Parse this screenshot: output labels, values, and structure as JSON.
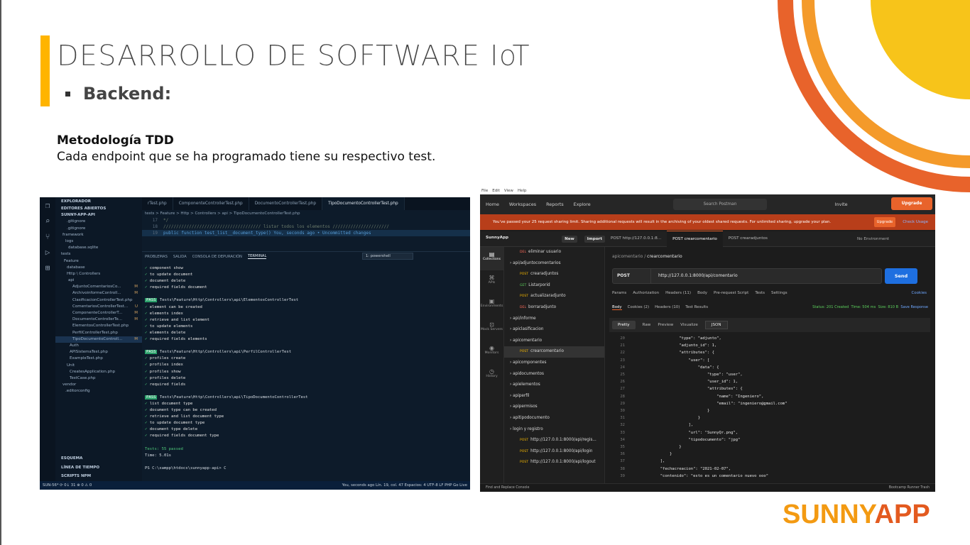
{
  "slide": {
    "title": "DESARROLLO DE SOFTWARE IoT",
    "bullet": "Backend:",
    "section_title": "Metodología TDD",
    "section_desc": "Cada endpoint que se ha programado tiene su respectivo test.",
    "logo_part1": "SUNNY",
    "logo_part2": "APP"
  },
  "colors": {
    "accent_yellow": "#ffb400",
    "arc_orange": "#e8632b",
    "arc_yellow": "#f7c41a"
  },
  "vscode": {
    "sidebar_title": "EXPLORADOR",
    "open_editors": "EDITORES ABIERTOS",
    "project": "SUNNY-APP-API",
    "tree": [
      {
        "label": ".gitignore",
        "badge": ""
      },
      {
        "label": ".gitignore",
        "badge": ""
      },
      {
        "label": "framework",
        "badge": ""
      },
      {
        "label": "logs",
        "badge": ""
      },
      {
        "label": "database.sqlite",
        "badge": ""
      },
      {
        "label": "tests",
        "badge": ""
      },
      {
        "label": "Feature",
        "badge": ""
      },
      {
        "label": "database",
        "badge": ""
      },
      {
        "label": "Http \\ Controllers",
        "badge": ""
      },
      {
        "label": "api",
        "badge": ""
      },
      {
        "label": "AdjuntoComentariosCo...",
        "badge": "M"
      },
      {
        "label": "ArchivoinformeControll...",
        "badge": "M"
      },
      {
        "label": "ClasificacionControllerTest.php",
        "badge": ""
      },
      {
        "label": "ComentariosControllerTest...",
        "badge": "U"
      },
      {
        "label": "ComponenteControllerT...",
        "badge": "M"
      },
      {
        "label": "DocumentoControllerTe...",
        "badge": "M"
      },
      {
        "label": "ElementosControllerTest.php",
        "badge": ""
      },
      {
        "label": "PerfilControllerTest.php",
        "badge": ""
      },
      {
        "label": "TipoDocumentoControll...",
        "badge": "M"
      },
      {
        "label": "Auth",
        "badge": ""
      },
      {
        "label": "APISistemaTest.php",
        "badge": ""
      },
      {
        "label": "ExampleTest.php",
        "badge": ""
      },
      {
        "label": "Unit",
        "badge": ""
      },
      {
        "label": "CreatesApplication.php",
        "badge": ""
      },
      {
        "label": "TestCase.php",
        "badge": ""
      },
      {
        "label": "vendor",
        "badge": ""
      },
      {
        "label": ".editorconfig",
        "badge": ""
      }
    ],
    "outline": "ESQUEMA",
    "timeline": "LÍNEA DE TIEMPO",
    "npm": "SCRIPTS NPM",
    "tabs": [
      "rTest.php",
      "ComponenteControllerTest.php",
      "DocumentoControllerTest.php",
      "TipoDocumentoControllerTest.php"
    ],
    "breadcrumb": "tests > Feature > Http > Controllers > api > TipoDocumentoControllerTest.php",
    "code_lines": [
      {
        "n": "17",
        "text": "*/"
      },
      {
        "n": "18",
        "text": "////////////////////////////////////// listar todos los elementos //////////////////////"
      },
      {
        "n": "19",
        "text": "public function test_list__document_type()       You, seconds ago • Uncommitted changes"
      }
    ],
    "panel_tabs": [
      "PROBLEMAS",
      "SALIDA",
      "CONSOLA DE DEPURACIÓN",
      "TERMINAL"
    ],
    "shell": "1: powershell",
    "terminal": [
      "✓ component show",
      "✓ to update document",
      "✓ document delete",
      "✓ required fields document",
      "",
      "PASS  Tests\\Feature\\Http\\Controllers\\api\\ElementosControllerTest",
      "✓ element can be created",
      "✓ elements index",
      "✓ retrieve and list element",
      "✓ to update elements",
      "✓ elements delete",
      "✓ required fields elements",
      "",
      "PASS  Tests\\Feature\\Http\\Controllers\\api\\PerfilControllerTest",
      "✓ profiles create",
      "✓ profiles index",
      "✓ profiles show",
      "✓ profiles delete",
      "✓ required fields",
      "",
      "PASS  Tests\\Feature\\Http\\Controllers\\api\\TipoDocumentoControllerTest",
      "✓ list  document type",
      "✓ document type can be created",
      "✓ retrieve and list  document type",
      "✓ to update document type",
      "✓ document type delete",
      "✓ required fields document type",
      "",
      "Tests:  55 passed",
      "Time:   5.01s",
      "",
      "PS C:\\xampp\\htdocs\\sunnyapp-api> C"
    ],
    "status_left": "SUN-56*  ⟳ 0↓ 31  ⊗ 0 ⚠ 0",
    "status_right": "You, seconds ago   Lín. 19, col. 47   Espacios: 4   UTF-8   LF   PHP   Go Live"
  },
  "postman": {
    "menubar": [
      "File",
      "Edit",
      "View",
      "Help"
    ],
    "nav": [
      "Home",
      "Workspaces",
      "Reports",
      "Explore"
    ],
    "search": "Search Postman",
    "invite": "Invite",
    "upgrade": "Upgrade",
    "warning": "You've passed your 25 request sharing limit. Sharing additional requests will result in the archiving of your oldest shared requests. For unlimited sharing, upgrade your plan.",
    "warning_btn": "Upgrade",
    "warning_link": "Check Usage",
    "workspace": "SunnyApp",
    "new_btn": "New",
    "import_btn": "Import",
    "req_tabs": [
      "POST  http://127.0.0.1:8...",
      "POST  crearcomentario",
      "POST  crearadjuntos"
    ],
    "env": "No Environment",
    "rail": [
      "Collections",
      "APIs",
      "Environments",
      "Mock Servers",
      "Monitors",
      "History"
    ],
    "tree": [
      {
        "m": "DEL",
        "label": "eliminar usuario",
        "indent": 2
      },
      {
        "m": "",
        "label": "api/adjuntocomentarios",
        "indent": 1
      },
      {
        "m": "POST",
        "label": "crearadjuntos",
        "indent": 2
      },
      {
        "m": "GET",
        "label": "Listarporid",
        "indent": 2
      },
      {
        "m": "POST",
        "label": "actualizaradjunto",
        "indent": 2
      },
      {
        "m": "DEL",
        "label": "borraradjunto",
        "indent": 2
      },
      {
        "m": "",
        "label": "api/informe",
        "indent": 1
      },
      {
        "m": "",
        "label": "apiclasificacion",
        "indent": 1
      },
      {
        "m": "",
        "label": "apicomentario",
        "indent": 1
      },
      {
        "m": "POST",
        "label": "crearcomentario",
        "indent": 2
      },
      {
        "m": "",
        "label": "apicomponentes",
        "indent": 1
      },
      {
        "m": "",
        "label": "apidocumentos",
        "indent": 1
      },
      {
        "m": "",
        "label": "apielementos",
        "indent": 1
      },
      {
        "m": "",
        "label": "apiperfil",
        "indent": 1
      },
      {
        "m": "",
        "label": "apipermisos",
        "indent": 1
      },
      {
        "m": "",
        "label": "apitipodocumento",
        "indent": 1
      },
      {
        "m": "",
        "label": "login y registro",
        "indent": 1
      },
      {
        "m": "POST",
        "label": "http://127.0.0.1:8000/api/regis...",
        "indent": 2
      },
      {
        "m": "POST",
        "label": "http://127.0.0.1:8000/api/login",
        "indent": 2
      },
      {
        "m": "POST",
        "label": "http://127.0.0.1:8000/api/logout",
        "indent": 2
      }
    ],
    "crumb_parent": "apicomentario",
    "crumb_current": "crearcomentario",
    "method": "POST",
    "url": "http://127.0.0.1:8000/api/comentario",
    "send": "Send",
    "req_subtabs": [
      "Params",
      "Authorization",
      "Headers (11)",
      "Body",
      "Pre-request Script",
      "Tests",
      "Settings"
    ],
    "cookies": "Cookies",
    "res_tabs": [
      "Body",
      "Cookies (2)",
      "Headers (10)",
      "Test Results"
    ],
    "status": "Status: 201 Created",
    "time": "Time: 504 ms",
    "size": "Size: 810 B",
    "save_response": "Save Response",
    "fmt": [
      "Pretty",
      "Raw",
      "Preview",
      "Visualize"
    ],
    "fmt_type": "JSON",
    "body_lines": [
      {
        "n": "20",
        "t": "                    \"type\": \"adjunto\","
      },
      {
        "n": "21",
        "t": "                    \"adjunto_id\": 1,"
      },
      {
        "n": "22",
        "t": "                    \"attributes\": {"
      },
      {
        "n": "23",
        "t": "                        \"user\": ["
      },
      {
        "n": "24",
        "t": "                            \"data\": {"
      },
      {
        "n": "25",
        "t": "                                \"type\": \"user\","
      },
      {
        "n": "26",
        "t": "                                \"user_id\": 1,"
      },
      {
        "n": "27",
        "t": "                                \"attributes\": {"
      },
      {
        "n": "28",
        "t": "                                    \"name\": \"Ingeniero\","
      },
      {
        "n": "29",
        "t": "                                    \"email\": \"ingeniero@gmail.com\""
      },
      {
        "n": "30",
        "t": "                                }"
      },
      {
        "n": "31",
        "t": "                            }"
      },
      {
        "n": "32",
        "t": "                        ],"
      },
      {
        "n": "33",
        "t": "                        \"url\": \"SunnyQr.png\","
      },
      {
        "n": "34",
        "t": "                        \"tipodocumento\": \"jpg\""
      },
      {
        "n": "35",
        "t": "                    }"
      },
      {
        "n": "36",
        "t": "                }"
      },
      {
        "n": "37",
        "t": "            ],"
      },
      {
        "n": "38",
        "t": "            \"fechacreacion\": \"2021-02-07\","
      },
      {
        "n": "39",
        "t": "            \"contenido\": \"esto es un comentario nuevo ooo\""
      }
    ],
    "bottom_left": "Find and Replace     Console",
    "bottom_right": "Bootcamp   Runner   Trash"
  }
}
